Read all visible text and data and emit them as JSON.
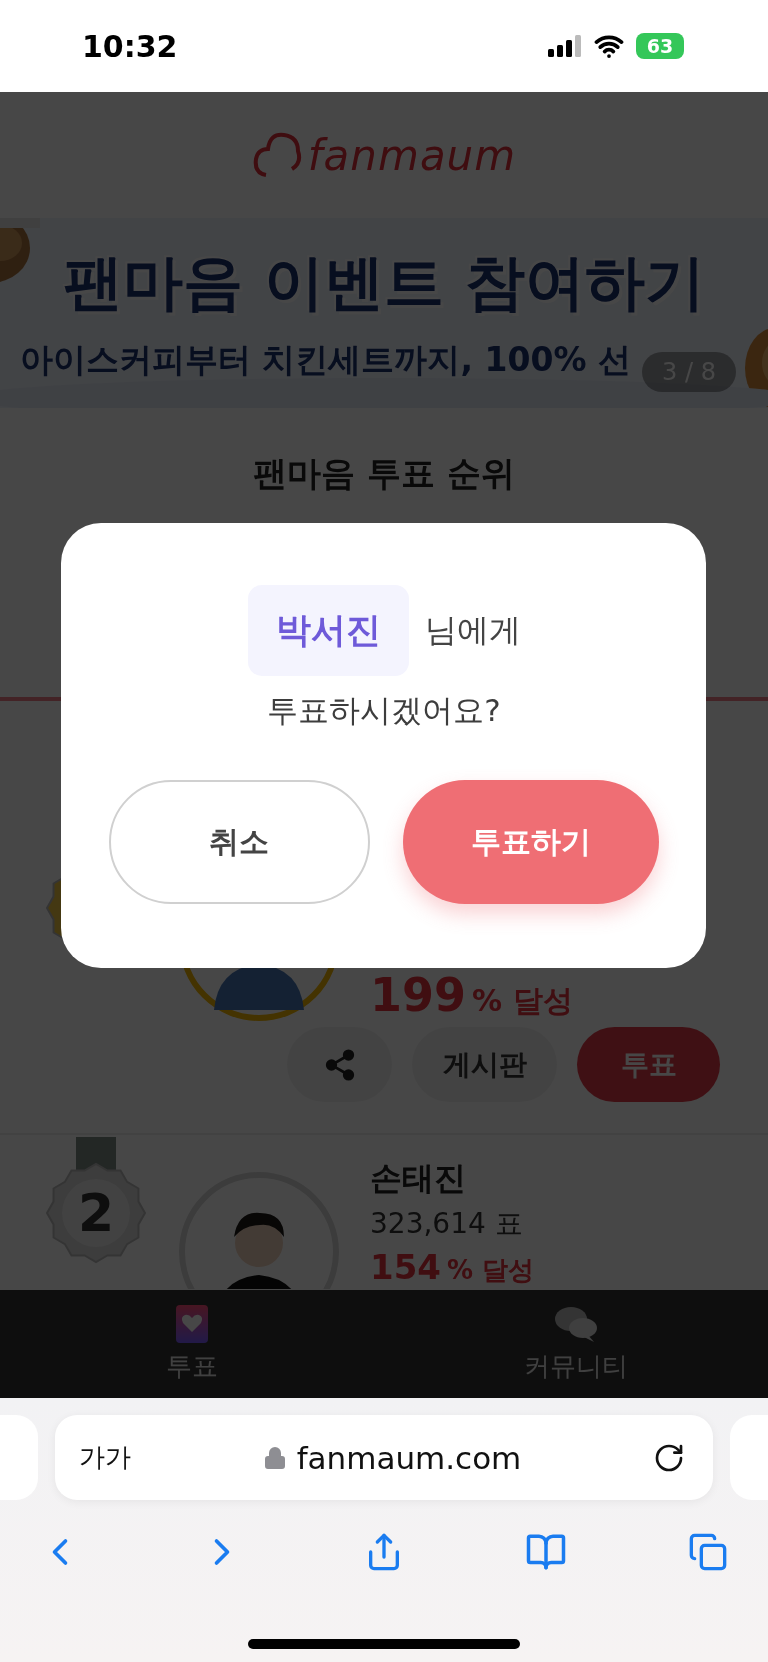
{
  "status_bar": {
    "time": "10:32",
    "battery": "63"
  },
  "header": {
    "logo": "fanmaum"
  },
  "banner": {
    "title": "팬마음 이벤트 참여하기",
    "subtitle": "아이스커피부터 치킨세트까지, 100% 선",
    "counter": "3 / 8"
  },
  "ranking": {
    "title": "팬마음 투표 순위",
    "entries": [
      {
        "kind": "gold",
        "achievement_number": "199",
        "achievement_label": "% 달성",
        "actions": {
          "board": "게시판",
          "vote": "투표"
        }
      },
      {
        "kind": "silver",
        "rank": "2",
        "name": "손태진",
        "votes": "323,614 표",
        "achievement_number": "154",
        "achievement_label": "% 달성"
      }
    ]
  },
  "tab_bar": [
    {
      "kind": "heart",
      "label": "투표"
    },
    {
      "kind": "chat",
      "label": "커뮤니티"
    }
  ],
  "dialog": {
    "name": "박서진",
    "name_suffix": "님에게",
    "question": "투표하시겠어요?",
    "cancel": "취소",
    "confirm": "투표하기"
  },
  "browser": {
    "text_size": "가가",
    "url": "fanmaum.com"
  }
}
